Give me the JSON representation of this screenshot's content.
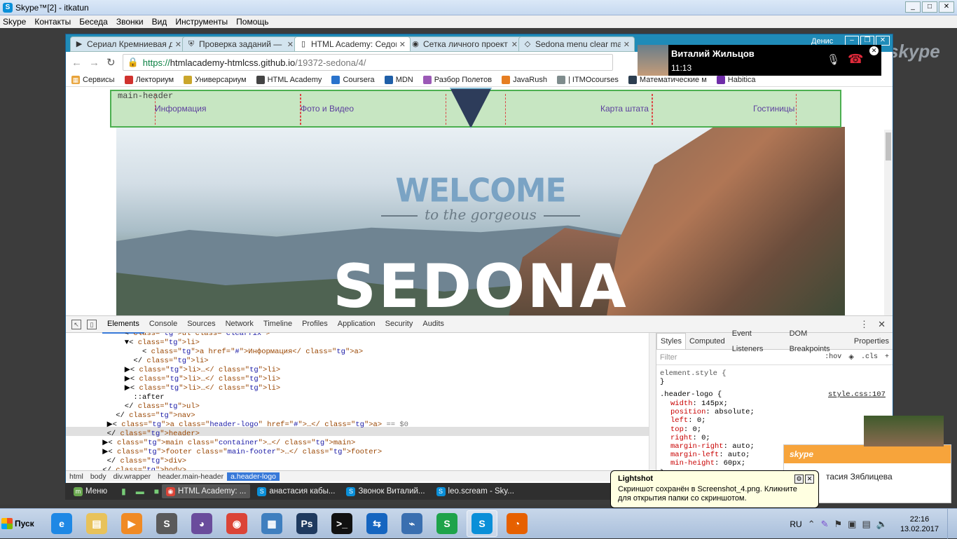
{
  "skype": {
    "title": "Skype™[2] - itkatun",
    "menu": [
      "Skype",
      "Контакты",
      "Беседа",
      "Звонки",
      "Вид",
      "Инструменты",
      "Помощь"
    ],
    "logo": "skype"
  },
  "browser": {
    "profile": "Денис",
    "tabs": [
      {
        "icon": "play-icon",
        "label": "Сериал Кремниевая д",
        "active": false
      },
      {
        "icon": "shield-icon",
        "label": "Проверка заданий —",
        "active": false
      },
      {
        "icon": "page-icon",
        "label": "HTML Academy: Седон",
        "active": true
      },
      {
        "icon": "github-icon",
        "label": "Сетка личного проект",
        "active": false
      },
      {
        "icon": "codepen-icon",
        "label": "Sedona menu clear ma",
        "active": false
      }
    ],
    "url": {
      "scheme": "https://",
      "host": "htmlacademy-htmlcss.github.io",
      "path": "/19372-sedona/4/"
    },
    "bookmarks": [
      {
        "label": "Сервисы",
        "color": "#e8a33a"
      },
      {
        "label": "Лекториум",
        "color": "#d0322e"
      },
      {
        "label": "Универсариум",
        "color": "#caa62c"
      },
      {
        "label": "HTML Academy",
        "color": "#444444"
      },
      {
        "label": "Coursera",
        "color": "#2a73cc"
      },
      {
        "label": "MDN",
        "color": "#1f5fa8"
      },
      {
        "label": "Разбор Полетов",
        "color": "#9b59b6"
      },
      {
        "label": "JavaRush",
        "color": "#e67e22"
      },
      {
        "label": "| ITMOcourses",
        "color": "#7f8c8d"
      },
      {
        "label": "Математические м",
        "color": "#2c3e50"
      },
      {
        "label": "Habitica",
        "color": "#6f2da8"
      }
    ]
  },
  "page": {
    "header_label": "main-header",
    "nav": [
      "Информация",
      "Фото и Видео",
      "Карта штата",
      "Гостиницы"
    ],
    "welcome": "WELCOME",
    "gorgeous": "to the gorgeous",
    "sedona": "SEDONA"
  },
  "devtools": {
    "tabs": [
      "Elements",
      "Console",
      "Sources",
      "Network",
      "Timeline",
      "Profiles",
      "Application",
      "Security",
      "Audits"
    ],
    "active_tab": "Elements",
    "dom": [
      {
        "indent": "      ",
        "html": "<ul class=\"clearfix\">"
      },
      {
        "indent": "      ",
        "html": "▼<li>"
      },
      {
        "indent": "          ",
        "html": "<a href=\"#\">Информация</a>"
      },
      {
        "indent": "        ",
        "html": "</li>"
      },
      {
        "indent": "      ",
        "html": "▶<li>…</li>"
      },
      {
        "indent": "      ",
        "html": "▶<li>…</li>"
      },
      {
        "indent": "      ",
        "html": "▶<li>…</li>"
      },
      {
        "indent": "        ",
        "html": "::after"
      },
      {
        "indent": "      ",
        "html": "</ul>"
      },
      {
        "indent": "    ",
        "html": "</nav>"
      },
      {
        "indent": "  ",
        "html": "▶<a class=\"header-logo\" href=\"#\">…</a> == $0"
      },
      {
        "indent": "  ",
        "html": "</header>"
      },
      {
        "indent": " ",
        "html": "▶<main class=\"container\">…</main>"
      },
      {
        "indent": " ",
        "html": "▶<footer class=\"main-footer\">…</footer>"
      },
      {
        "indent": "  ",
        "html": "</div>"
      },
      {
        "indent": " ",
        "html": "</body>"
      }
    ],
    "breadcrumbs": [
      "html",
      "body",
      "div.wrapper",
      "header.main-header",
      "a.header-logo"
    ],
    "styles_tabs": [
      "Styles",
      "Computed",
      "Event Listeners",
      "DOM Breakpoints",
      "Properties"
    ],
    "filter_placeholder": "Filter",
    "filter_hov": ":hov",
    "filter_cls": ".cls",
    "element_style": "element.style {",
    "rule_selector": ".header-logo {",
    "rule_source": "style.css:107",
    "props": [
      {
        "name": "width",
        "value": "145px;"
      },
      {
        "name": "position",
        "value": "absolute;"
      },
      {
        "name": "left",
        "value": "0;"
      },
      {
        "name": "top",
        "value": "0;"
      },
      {
        "name": "right",
        "value": "0;"
      },
      {
        "name": "margin-right",
        "value": "auto;"
      },
      {
        "name": "margin-left",
        "value": "auto;"
      },
      {
        "name": "min-height",
        "value": "60px;"
      }
    ]
  },
  "inner_taskbar": [
    {
      "label": "Меню",
      "active": false
    },
    {
      "label": "HTML Academy: ...",
      "active": true
    },
    {
      "label": "анастасия кабы...",
      "active": false
    },
    {
      "label": "Звонок Виталий...",
      "active": false
    },
    {
      "label": "leo.scream - Sky...",
      "active": false
    }
  ],
  "call": {
    "name": "Виталий Жильцов",
    "time": "11:13"
  },
  "notification": {
    "brand": "skype",
    "name": "тасия Зяблицева"
  },
  "lightshot": {
    "title": "Lightshot",
    "text": "Скриншот сохранён в Screenshot_4.png. Кликните для открытия папки со скриншотом."
  },
  "taskbar": {
    "start": "Пуск",
    "apps": [
      {
        "name": "ie-icon",
        "letter": "e",
        "color": "#1e88e5",
        "open": false
      },
      {
        "name": "explorer-icon",
        "letter": "▤",
        "color": "#e8c25a",
        "open": false
      },
      {
        "name": "media-icon",
        "letter": "▶",
        "color": "#f08a24",
        "open": false
      },
      {
        "name": "sublime-icon",
        "letter": "S",
        "color": "#5a5a5a",
        "open": false
      },
      {
        "name": "cat-icon",
        "letter": "◕",
        "color": "#6a4c9c",
        "open": false
      },
      {
        "name": "chrome-icon",
        "letter": "◉",
        "color": "#db4437",
        "open": false
      },
      {
        "name": "photo-icon",
        "letter": "▦",
        "color": "#3f7fbf",
        "open": false
      },
      {
        "name": "photoshop-icon",
        "letter": "Ps",
        "color": "#1f3a5f",
        "open": false
      },
      {
        "name": "cmd-icon",
        "letter": ">_",
        "color": "#111111",
        "open": false
      },
      {
        "name": "teamviewer-icon",
        "letter": "⇆",
        "color": "#1565c0",
        "open": false
      },
      {
        "name": "network-icon",
        "letter": "⌁",
        "color": "#3a6fb0",
        "open": false
      },
      {
        "name": "app-s-icon",
        "letter": "S",
        "color": "#1ea34a",
        "open": false
      },
      {
        "name": "skype-icon",
        "letter": "S",
        "color": "#0a8fd8",
        "open": true
      },
      {
        "name": "firefox-icon",
        "letter": "◔",
        "color": "#e66000",
        "open": false
      }
    ],
    "lang": "RU",
    "time": "22:16",
    "date": "13.02.2017"
  }
}
